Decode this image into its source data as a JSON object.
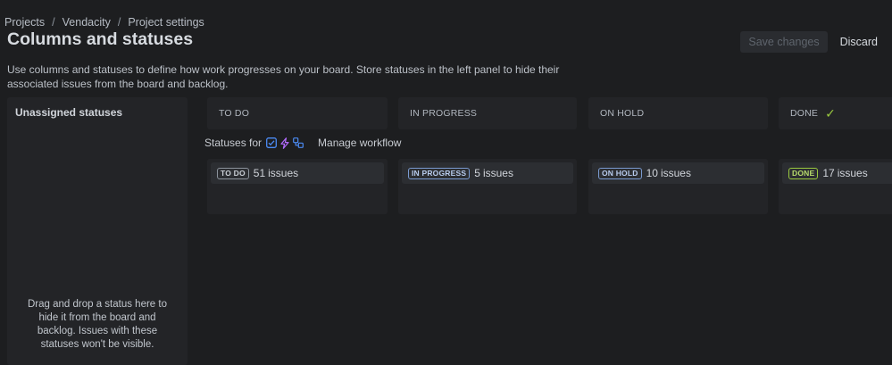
{
  "breadcrumb": [
    {
      "label": "Projects"
    },
    {
      "label": "Vendacity"
    },
    {
      "label": "Project settings"
    }
  ],
  "breadcrumb_separator": "/",
  "page_title": "Columns and statuses",
  "actions": {
    "save_label": "Save changes",
    "discard_label": "Discard"
  },
  "description": "Use columns and statuses to define how work progresses on your board. Store statuses in the left panel to hide their associated issues from the board and backlog.",
  "unassigned": {
    "title": "Unassigned statuses",
    "hint": "Drag and drop a status here to hide it from the board and backlog. Issues with these statuses won't be visible."
  },
  "statuses_for": {
    "label": "Statuses for",
    "icons": [
      "task-checkbox-icon",
      "subtask-lightning-icon",
      "story-hierarchy-icon"
    ],
    "manage_workflow": "Manage workflow"
  },
  "columns": [
    {
      "name": "TO DO",
      "status": "TO DO",
      "count": "51",
      "unit": "issues",
      "tone": "gray"
    },
    {
      "name": "IN PROGRESS",
      "status": "IN PROGRESS",
      "count": "5",
      "unit": "issues",
      "tone": "blue"
    },
    {
      "name": "ON HOLD",
      "status": "ON HOLD",
      "count": "10",
      "unit": "issues",
      "tone": "blue"
    },
    {
      "name": "DONE",
      "status": "DONE",
      "count": "17",
      "unit": "issues",
      "tone": "green",
      "done_check": true
    }
  ],
  "colors": {
    "background": "#1d1e20",
    "panel": "#232427",
    "done_green": "#9ac93f",
    "in_progress_blue": "#7a9bd1",
    "icon_blue": "#4c8cf5",
    "icon_purple": "#b36bff"
  }
}
